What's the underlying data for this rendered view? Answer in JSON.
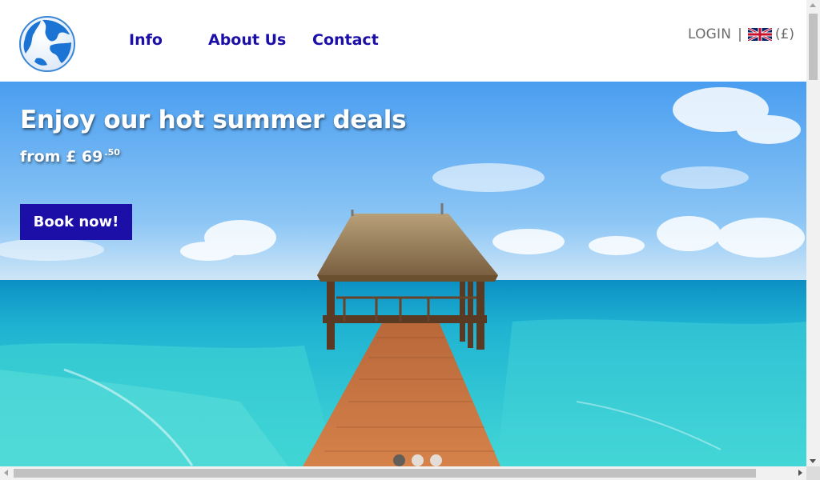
{
  "header": {
    "logo_icon": "globe-icon",
    "nav": [
      "Info",
      "About Us",
      "Contact"
    ],
    "login_label": "LOGIN",
    "separator": "|",
    "flag_icon": "uk-flag-icon",
    "currency_label": "(£)"
  },
  "hero": {
    "title": "Enjoy our hot summer deals",
    "price_prefix": "from £ 69",
    "price_cents": ".50",
    "cta_label": "Book now!",
    "slides_total": 3,
    "active_slide": 1,
    "scene": "beach-pier-image"
  },
  "colors": {
    "brand": "#1b0fa8",
    "text_muted": "#6b6b6b",
    "sky": "#5fa9ee",
    "sea": "#2fc3cf"
  }
}
